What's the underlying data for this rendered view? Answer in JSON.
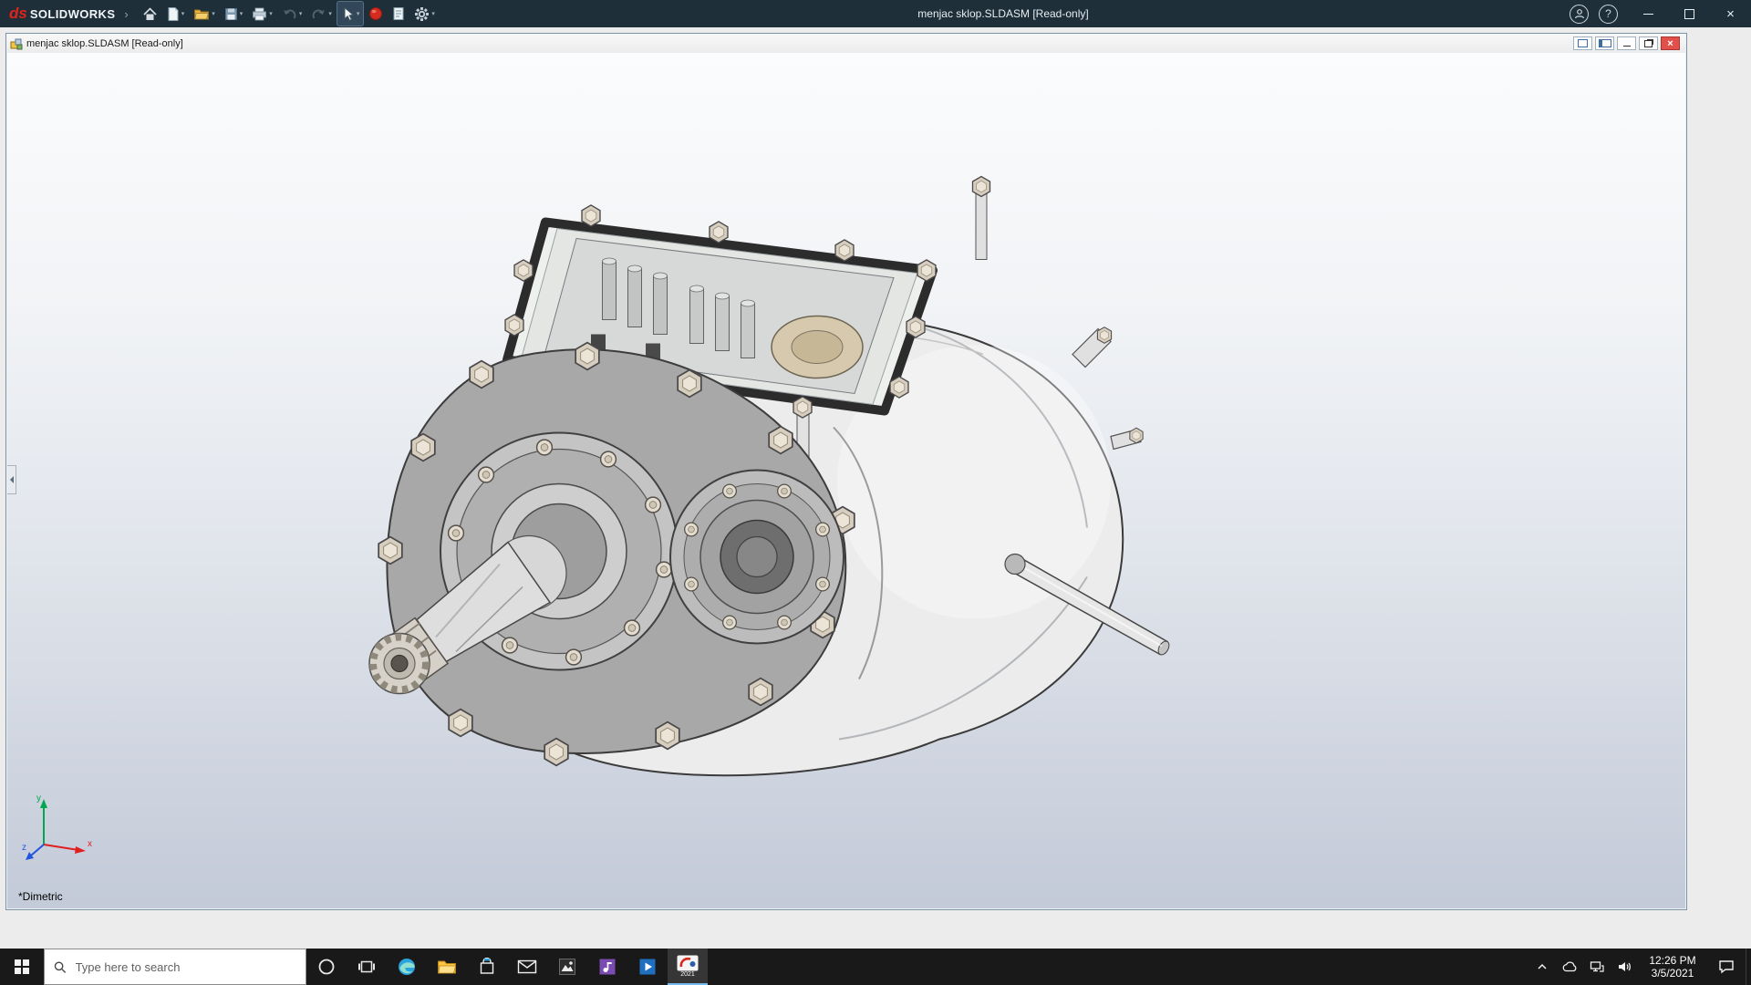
{
  "app_titlebar": {
    "title": "menjac sklop.SLDASM [Read-only]",
    "brand": {
      "mark": "ds",
      "name": "SOLIDWORKS"
    },
    "toolbar_icons": [
      "home-icon",
      "new-document-icon",
      "open-icon",
      "save-icon",
      "print-icon",
      "undo-icon",
      "redo-icon",
      "select-cursor-icon",
      "lifecycle-red-ball-icon",
      "file-properties-icon",
      "options-gear-icon"
    ],
    "window_controls": [
      "user-account-icon",
      "help-icon",
      "minimize-button",
      "maximize-button",
      "close-button"
    ]
  },
  "glyphs": {
    "caret": "▾",
    "flyout": "›",
    "close": "×",
    "help": "?"
  },
  "document_window": {
    "title": "menjac sklop.SLDASM [Read-only]",
    "controls": [
      "doc-pane-button-1",
      "doc-pane-button-2",
      "doc-minimize-button",
      "doc-restore-button",
      "doc-close-button"
    ]
  },
  "viewport": {
    "view_label": "*Dimetric",
    "triad_labels": {
      "x": "x",
      "y": "y",
      "z": "z"
    },
    "model_description": "gearbox assembly with open top cover, front flange with two circular bosses, splined input shaft and thin output shaft"
  },
  "taskbar": {
    "search": {
      "placeholder": "Type here to search"
    },
    "apps": [
      "cortana",
      "task-view",
      "edge",
      "file-explorer",
      "store",
      "mail",
      "photos",
      "media-player",
      "video-app",
      "solidworks-2021"
    ],
    "solidworks_badge": "2021",
    "tray": {
      "icons": [
        "hidden-icons-chevron",
        "cloud-icon",
        "network-icon",
        "volume-icon",
        "action-center-icon"
      ],
      "time": "12:26 PM",
      "date": "3/5/2021"
    }
  }
}
